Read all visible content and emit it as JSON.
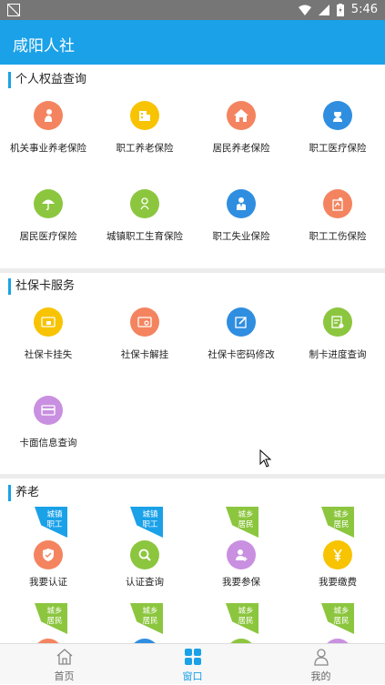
{
  "status": {
    "time": "5:46"
  },
  "appbar": {
    "title": "咸阳人社"
  },
  "sections": {
    "rights": {
      "title": "个人权益查询",
      "items": [
        {
          "label": "机关事业养老保险",
          "color": "#f4845f",
          "icon": "person-icon"
        },
        {
          "label": "职工养老保险",
          "color": "#f8c300",
          "icon": "building-icon"
        },
        {
          "label": "居民养老保险",
          "color": "#f4845f",
          "icon": "house-icon"
        },
        {
          "label": "职工医疗保险",
          "color": "#2f8ee0",
          "icon": "nurse-icon"
        },
        {
          "label": "居民医疗保险",
          "color": "#8cc63f",
          "icon": "umbrella-icon"
        },
        {
          "label": "城镇职工生育保险",
          "color": "#8cc63f",
          "icon": "baby-icon"
        },
        {
          "label": "职工失业保险",
          "color": "#2f8ee0",
          "icon": "worker-icon"
        },
        {
          "label": "职工工伤保险",
          "color": "#f4845f",
          "icon": "injury-icon"
        }
      ]
    },
    "card": {
      "title": "社保卡服务",
      "items": [
        {
          "label": "社保卡挂失",
          "color": "#f8c300",
          "icon": "card-lock-icon"
        },
        {
          "label": "社保卡解挂",
          "color": "#f4845f",
          "icon": "card-unlock-icon"
        },
        {
          "label": "社保卡密码修改",
          "color": "#2f8ee0",
          "icon": "edit-icon"
        },
        {
          "label": "制卡进度查询",
          "color": "#8cc63f",
          "icon": "progress-icon"
        },
        {
          "label": "卡面信息查询",
          "color": "#c98fe0",
          "icon": "card-info-icon"
        }
      ]
    },
    "pension": {
      "title": "养老",
      "items": [
        {
          "label": "我要认证",
          "color": "#f4845f",
          "icon": "shield-check-icon",
          "ribbon": "城镇\n职工",
          "ribbon_color": "blue"
        },
        {
          "label": "认证查询",
          "color": "#8cc63f",
          "icon": "search-icon",
          "ribbon": "城镇\n职工",
          "ribbon_color": "blue"
        },
        {
          "label": "我要参保",
          "color": "#c98fe0",
          "icon": "add-person-icon",
          "ribbon": "城乡\n居民",
          "ribbon_color": "green"
        },
        {
          "label": "我要缴费",
          "color": "#f8c300",
          "icon": "yen-icon",
          "ribbon": "城乡\n居民",
          "ribbon_color": "green"
        }
      ],
      "row2_ribbons": [
        "城乡\n居民",
        "城乡\n居民",
        "城乡\n居民",
        "城乡\n居民"
      ]
    }
  },
  "tabs": [
    {
      "label": "首页",
      "icon": "home-icon",
      "active": false
    },
    {
      "label": "窗口",
      "icon": "grid-icon",
      "active": true
    },
    {
      "label": "我的",
      "icon": "user-icon",
      "active": false
    }
  ],
  "colors": {
    "accent": "#1aa1e8",
    "statusbar": "#767676"
  }
}
